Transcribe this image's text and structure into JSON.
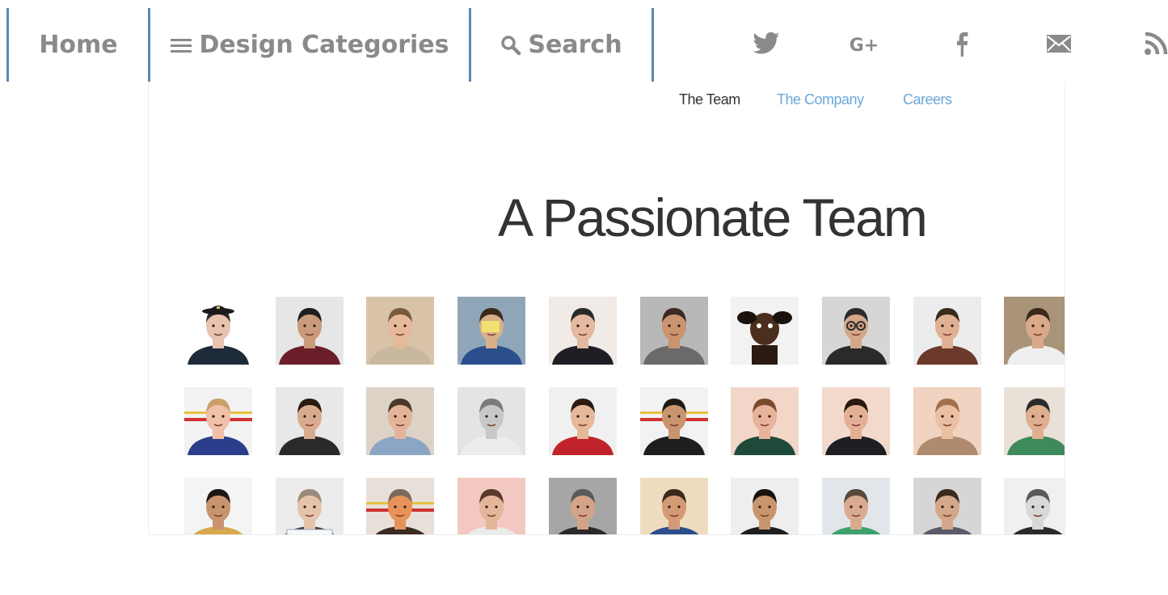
{
  "nav": {
    "home_label": "Home",
    "categories_label": "Design Categories",
    "search_label": "Search",
    "text_color": "#8a8a8a",
    "divider_color": "#5f87b0"
  },
  "social": {
    "google_plus_label": "G+",
    "icons": [
      "twitter-icon",
      "google-plus-icon",
      "facebook-icon",
      "mail-icon",
      "rss-icon"
    ]
  },
  "screenshot": {
    "subnav": {
      "team": "The Team",
      "company": "The Company",
      "careers": "Careers",
      "active_color": "#333333",
      "link_color": "#6aa8d8"
    },
    "heading": "A Passionate Team",
    "photo_rows": [
      [
        {
          "bg": "#ffffff",
          "skin": "#e8c3b0",
          "shirt": "#1d2b3a",
          "hair": "#2a2a2a",
          "hat": true
        },
        {
          "bg": "#e6e6e6",
          "skin": "#c99b7a",
          "shirt": "#6b1e2a",
          "hair": "#1e1e1e"
        },
        {
          "bg": "#d9c3a8",
          "skin": "#e6b99a",
          "shirt": "#c9b8a0",
          "hair": "#7a5a3a"
        },
        {
          "bg": "#8fa6b8",
          "skin": "#d8b08a",
          "shirt": "#2b4e8c",
          "hair": "#3a2a1a",
          "note": true
        },
        {
          "bg": "#f0ebe6",
          "skin": "#e3b9a0",
          "shirt": "#1e1e24",
          "hair": "#2a2a2a"
        },
        {
          "bg": "#b8b8b8",
          "skin": "#c9946e",
          "shirt": "#6a6a6a",
          "hair": "#3a2a22"
        },
        {
          "bg": "#f2f2f2",
          "skin": "#4a2e1e",
          "shirt": "#2a1a12",
          "hair": "#1a120c",
          "dog": true
        },
        {
          "bg": "#d6d6d6",
          "skin": "#d4a68a",
          "shirt": "#2a2a2a",
          "hair": "#2a2a2a",
          "glasses": true
        },
        {
          "bg": "#ececec",
          "skin": "#e0b094",
          "shirt": "#6b3a2a",
          "hair": "#3a2a1a"
        },
        {
          "bg": "#a9947a",
          "skin": "#d9a98a",
          "shirt": "#efefef",
          "hair": "#3a2a1a"
        }
      ],
      [
        {
          "bg": "#f2f2f2",
          "skin": "#f0c0a8",
          "shirt": "#2b3e8c",
          "hair": "#c9a06a",
          "stripe": true
        },
        {
          "bg": "#e8e8e8",
          "skin": "#d9ab8e",
          "shirt": "#2a2a2a",
          "hair": "#2a1a12"
        },
        {
          "bg": "#dcd2c6",
          "skin": "#e3b49a",
          "shirt": "#8aa6c4",
          "hair": "#4a3a2a"
        },
        {
          "bg": "#e4e4e4",
          "skin": "#c8c8c8",
          "shirt": "#ececec",
          "hair": "#7a7a7a"
        },
        {
          "bg": "#f0f0f0",
          "skin": "#e6b89a",
          "shirt": "#c0242a",
          "hair": "#2a1a12"
        },
        {
          "bg": "#f2f2f2",
          "skin": "#c8956e",
          "shirt": "#1e1e1e",
          "hair": "#1e1a16",
          "stripe": true
        },
        {
          "bg": "#f2d6c8",
          "skin": "#e8b39a",
          "shirt": "#1e4a3a",
          "hair": "#7a4a2a"
        },
        {
          "bg": "#f2d9cc",
          "skin": "#e3b096",
          "shirt": "#1e1e24",
          "hair": "#2a1a12"
        },
        {
          "bg": "#f0d3c0",
          "skin": "#ebbfa2",
          "shirt": "#b08a6e",
          "hair": "#a0704a"
        },
        {
          "bg": "#e9e1d8",
          "skin": "#e0ae90",
          "shirt": "#3e8a5a",
          "hair": "#2a2a2a"
        }
      ],
      [
        {
          "bg": "#f4f4f4",
          "skin": "#c8946e",
          "shirt": "#d8a84a",
          "hair": "#1e1612"
        },
        {
          "bg": "#ececec",
          "skin": "#e6c4ac",
          "shirt": "#3a3a3a",
          "hair": "#9a8a7a",
          "sign": true
        },
        {
          "bg": "#e8e0d8",
          "skin": "#e8925a",
          "shirt": "#3a2a22",
          "hair": "#7a6a5a",
          "stripe": true
        },
        {
          "bg": "#f2c8c0",
          "skin": "#e3b69a",
          "shirt": "#ebebeb",
          "hair": "#5a3a2a"
        },
        {
          "bg": "#a6a6a6",
          "skin": "#d4a488",
          "shirt": "#2a2a2a",
          "hair": "#5a5a5a"
        },
        {
          "bg": "#efdcbe",
          "skin": "#d49a76",
          "shirt": "#2b4e8c",
          "hair": "#3a2a1a"
        },
        {
          "bg": "#eeeeee",
          "skin": "#c9956e",
          "shirt": "#1e1e1e",
          "hair": "#1a120c"
        },
        {
          "bg": "#e2e6ea",
          "skin": "#d9ab8e",
          "shirt": "#3ea06a",
          "hair": "#5a4a3a"
        },
        {
          "bg": "#d6d6d6",
          "skin": "#d4a68a",
          "shirt": "#5a5a6a",
          "hair": "#3a2a1a"
        },
        {
          "bg": "#f0f0f0",
          "skin": "#d8d8d8",
          "shirt": "#2a2a2a",
          "hair": "#5a5a5a"
        }
      ]
    ]
  }
}
